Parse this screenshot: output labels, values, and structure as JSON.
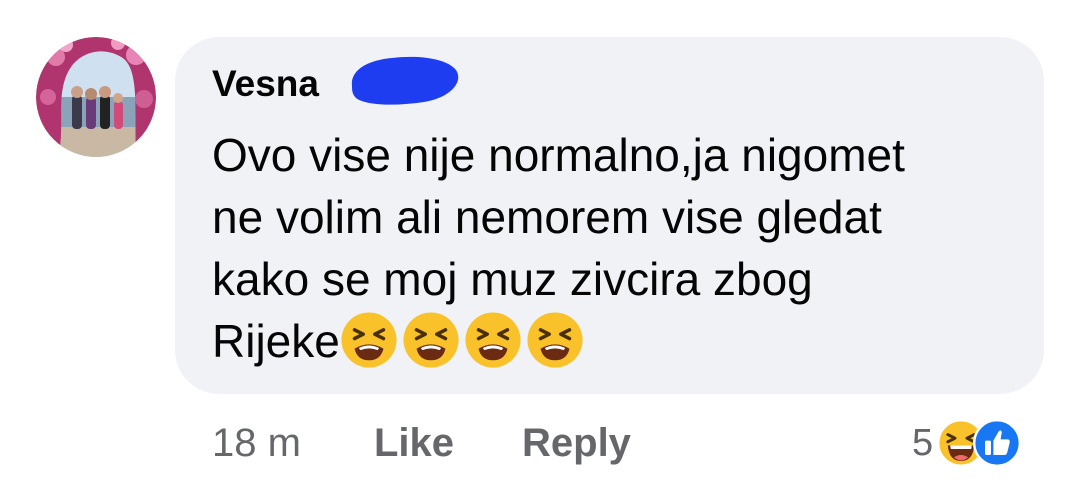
{
  "comment": {
    "author": "Vesna",
    "text_lines": [
      "Ovo vise nije normalno,ja nigomet",
      "ne volim ali nemorem vise gledat",
      "kako se moj muz zivcira zbog",
      "Rijeke"
    ],
    "emojis": [
      "tired-face-emoji",
      "tired-face-emoji",
      "tired-face-emoji",
      "tired-face-emoji"
    ]
  },
  "actions": {
    "time": "18 m",
    "like": "Like",
    "reply": "Reply"
  },
  "reactions": {
    "count": "5",
    "icons": [
      "haha-reaction-icon",
      "like-reaction-icon"
    ]
  },
  "colors": {
    "bubble": "#f0f2f5",
    "text": "#050505",
    "secondary": "#65676b",
    "redaction": "#1f3df0",
    "like_blue": "#1877f2"
  }
}
